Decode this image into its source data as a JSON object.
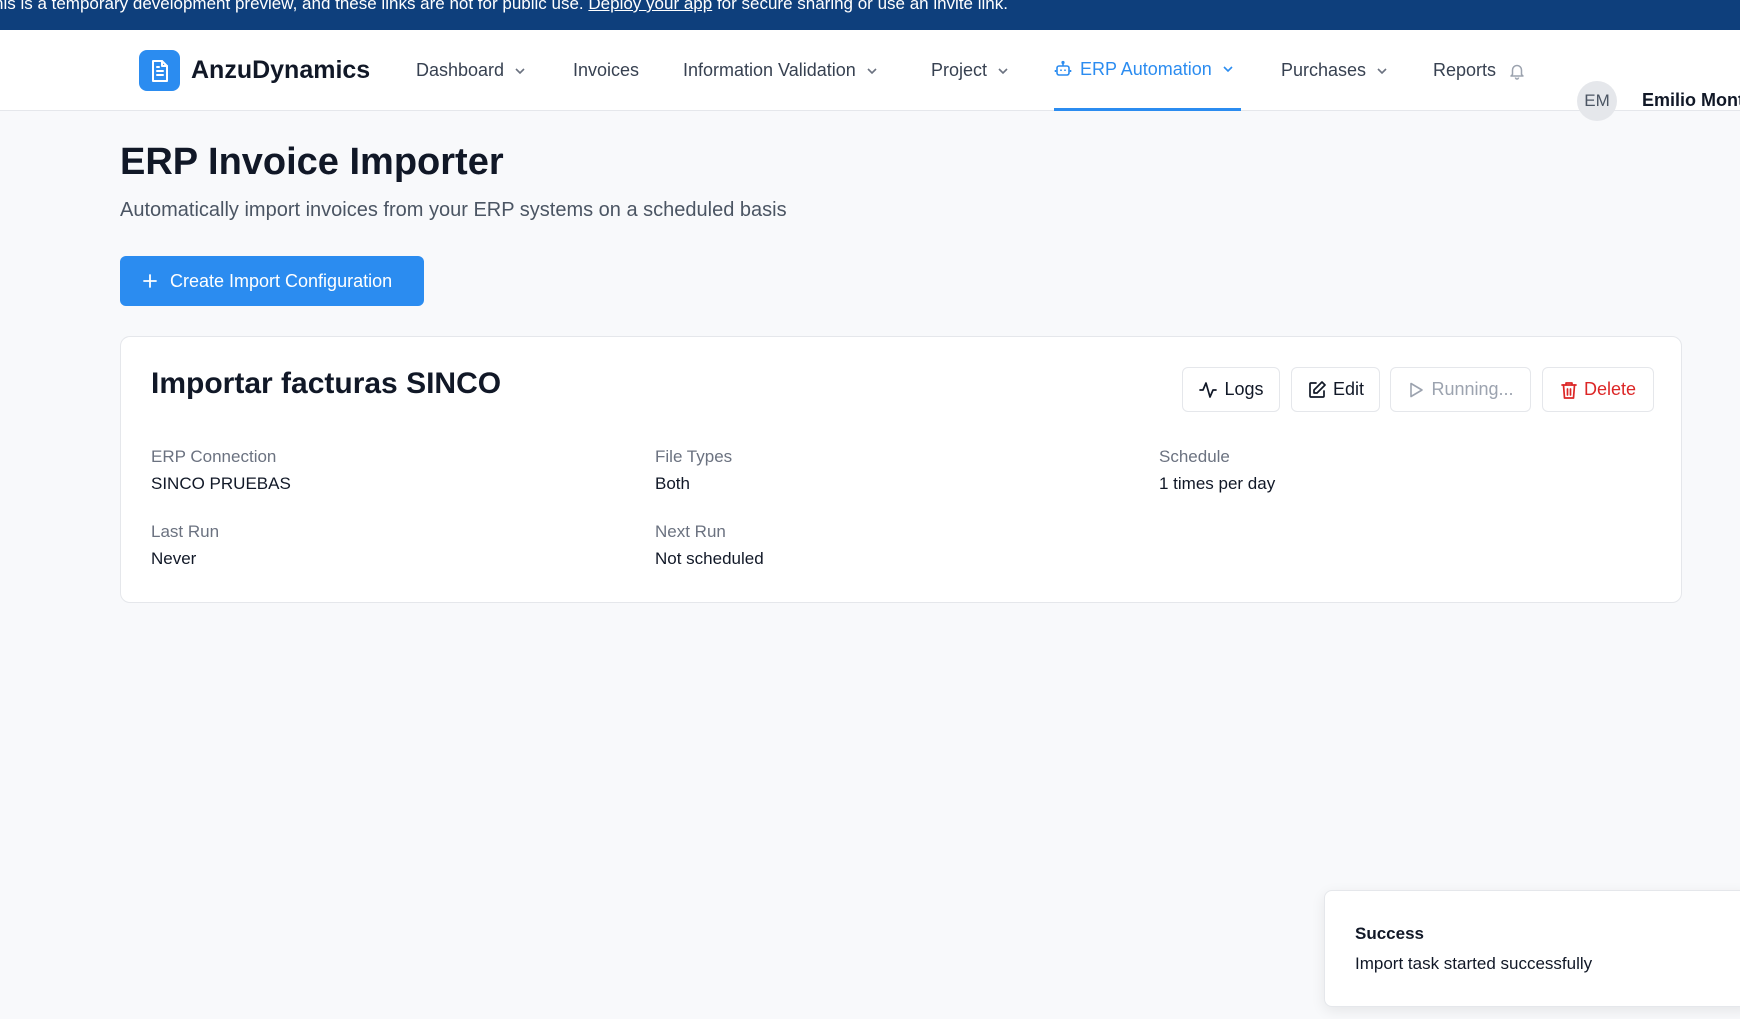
{
  "banner": {
    "text_before": "his is a temporary development preview, and these links are not for public use.",
    "link": "Deploy your app",
    "text_after": "for secure sharing or use an invite link."
  },
  "brand": {
    "name": "AnzuDynamics",
    "logo_icon": "document-icon",
    "color": "#2b8cf0"
  },
  "nav": {
    "items": [
      {
        "label": "Dashboard",
        "has_dropdown": true
      },
      {
        "label": "Invoices",
        "has_dropdown": false
      },
      {
        "label": "Information Validation",
        "has_dropdown": true
      },
      {
        "label": "Project",
        "has_dropdown": true
      },
      {
        "label": "ERP Automation",
        "has_dropdown": true,
        "active": true,
        "icon": "robot-icon"
      },
      {
        "label": "Purchases",
        "has_dropdown": true
      },
      {
        "label": "Reports",
        "has_dropdown": false
      }
    ],
    "notification_icon": "bell-icon",
    "active_color": "#2b8cf0"
  },
  "user": {
    "initials": "EM",
    "name": "Emilio Mont"
  },
  "page": {
    "title": "ERP Invoice Importer",
    "subtitle": "Automatically import invoices from your ERP systems on a scheduled basis",
    "create_button_label": "Create Import Configuration"
  },
  "config_card": {
    "title": "Importar facturas SINCO",
    "actions": {
      "logs": "Logs",
      "edit": "Edit",
      "run": "Running...",
      "delete": "Delete"
    },
    "fields": {
      "erp_connection": {
        "label": "ERP Connection",
        "value": "SINCO PRUEBAS"
      },
      "file_types": {
        "label": "File Types",
        "value": "Both"
      },
      "schedule": {
        "label": "Schedule",
        "value": "1 times per day"
      },
      "last_run": {
        "label": "Last Run",
        "value": "Never"
      },
      "next_run": {
        "label": "Next Run",
        "value": "Not scheduled"
      }
    }
  },
  "toast": {
    "title": "Success",
    "message": "Import task started successfully"
  },
  "colors": {
    "primary": "#2b8cf0",
    "banner_bg": "#0e3f7c",
    "danger": "#dc2626"
  }
}
